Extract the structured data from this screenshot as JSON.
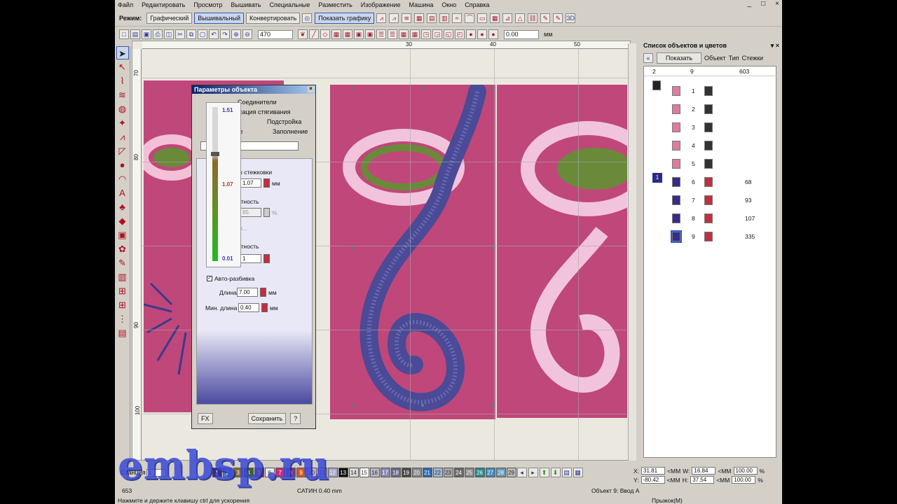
{
  "window": {
    "controls": [
      "_",
      "□",
      "×"
    ]
  },
  "menu": [
    "Файл",
    "Редактировать",
    "Просмотр",
    "Вышивать",
    "Специальные",
    "Разместить",
    "Изображение",
    "Машина",
    "Окно",
    "Справка"
  ],
  "toolbar1": {
    "mode_label": "Режим:",
    "modes": [
      "Графический",
      "Вышивальный",
      "Конвертировать"
    ],
    "show_graphics": "Показать графику",
    "three_d": "3D"
  },
  "toolbar2": {
    "zoom": "470",
    "value": "0.00",
    "unit": "мм"
  },
  "rulers": {
    "h": [
      "30",
      "40",
      "50"
    ],
    "v": [
      "70",
      "80",
      "90",
      "100"
    ]
  },
  "dialog": {
    "title": "Параметры объекта",
    "tabs": [
      "Соединители",
      "енсация стягивания",
      "Подстройка",
      "ые",
      "Заполнение"
    ],
    "stitch_params_label": "ры стежковки",
    "stitch_value": "1.07",
    "density_label": "отность",
    "density_value": "85",
    "pct": "%",
    "mode_label": "ры...",
    "repeat_label": "атность",
    "repeat_value": "1",
    "auto_split": "Авто-разбивка",
    "length_label": "Длина",
    "length_value": "7.00",
    "minlen_label": "Мин. длина",
    "minlen_value": "0.40",
    "unit": "мм",
    "fx": "FX",
    "save": "Сохранить",
    "help": "?",
    "slider": {
      "top": "1.51",
      "mid": "1.07",
      "bottom": "0.01",
      "level_fraction": 0.71
    }
  },
  "objects_panel": {
    "title": "Список объектов и цветов",
    "controls": "▾ ×",
    "show_button": "Показать",
    "col_object": "Объект",
    "col_type": "Тип",
    "col_stitches": "Стежки",
    "summary": {
      "a": "2",
      "b": "9",
      "c": "603"
    },
    "rows": [
      {
        "n": "1",
        "stitches": ""
      },
      {
        "n": "2",
        "stitches": ""
      },
      {
        "n": "3",
        "stitches": ""
      },
      {
        "n": "4",
        "stitches": ""
      },
      {
        "n": "5",
        "stitches": ""
      },
      {
        "n": "6",
        "stitches": "68"
      },
      {
        "n": "7",
        "stitches": "93"
      },
      {
        "n": "8",
        "stitches": "107"
      },
      {
        "n": "9",
        "stitches": "335"
      }
    ],
    "group_index": "1"
  },
  "palette": {
    "label": "Станция",
    "value": "1",
    "colors": [
      {
        "n": "1",
        "c": "#3a2a8a"
      },
      {
        "n": "2",
        "c": "#4a78c8"
      },
      {
        "n": "3",
        "c": "#8a6a2a"
      },
      {
        "n": "4",
        "c": "#3a6a2a"
      },
      {
        "n": "5",
        "c": "#c02a2a"
      },
      {
        "n": "6",
        "c": "#e8e8e8"
      },
      {
        "n": "7",
        "c": "#c0307a"
      },
      {
        "n": "8",
        "c": "#7a3a8a"
      },
      {
        "n": "9",
        "c": "#d85a1a"
      },
      {
        "n": "10",
        "c": "#c8a8d8"
      },
      {
        "n": "11",
        "c": "#c8b8e8"
      },
      {
        "n": "12",
        "c": "#a8a8c8"
      },
      {
        "n": "13",
        "c": "#111111"
      },
      {
        "n": "14",
        "c": "#d8d8d8"
      },
      {
        "n": "15",
        "c": "#ffffff"
      },
      {
        "n": "16",
        "c": "#b8b8c8"
      },
      {
        "n": "17",
        "c": "#8a8ab8"
      },
      {
        "n": "18",
        "c": "#6a6a8a"
      },
      {
        "n": "19",
        "c": "#4a4a4a"
      },
      {
        "n": "20",
        "c": "#8a8a8a"
      },
      {
        "n": "21",
        "c": "#2a6ab8"
      },
      {
        "n": "22",
        "c": "#9ab8d8"
      },
      {
        "n": "23",
        "c": "#a8a8a8"
      },
      {
        "n": "24",
        "c": "#6a6a6a"
      },
      {
        "n": "25",
        "c": "#8a8a8a"
      },
      {
        "n": "26",
        "c": "#2a8a8a"
      },
      {
        "n": "27",
        "c": "#4a8ab8"
      },
      {
        "n": "28",
        "c": "#6a9ab8"
      },
      {
        "n": "29",
        "c": "#b8b8b8"
      }
    ]
  },
  "coords": {
    "x_label": "X:",
    "x_val": "31.81",
    "y_label": "Y:",
    "y_val": "-80.42",
    "mm": "<MM",
    "w_label": "W:",
    "w_val": "16.84",
    "h_label": "H:",
    "h_val": "37.54",
    "wp": "100.00",
    "hp": "100.00",
    "pct": "%"
  },
  "status": {
    "left_num": "653",
    "hint": "Нажмите и держите клавишу ctrl для ускорения",
    "satin": "САТИН  0.40 mm",
    "object": "Объект 9: Ввод А",
    "jump": "Прыжок(М)"
  },
  "watermark": "embsp.ru"
}
